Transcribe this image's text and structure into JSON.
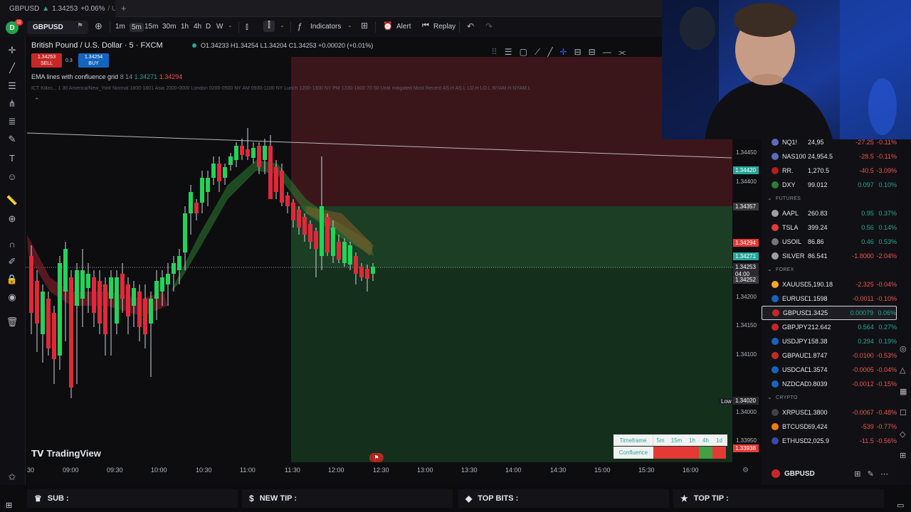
{
  "tab": {
    "symbol": "GBPUSD",
    "price": "1.34253",
    "change": "+0.06%",
    "title_rest": "/ Unn"
  },
  "toolbar": {
    "avatar_letter": "D",
    "avatar_badge": "11",
    "symbol": "GBPUSD",
    "intervals": [
      "1m",
      "5m",
      "15m",
      "30m",
      "1h",
      "4h",
      "D",
      "W"
    ],
    "active_interval": "5m",
    "indicators_label": "Indicators",
    "alert_label": "Alert",
    "replay_label": "Replay"
  },
  "legend": {
    "title": "British Pound / U.S. Dollar · 5 · FXCM",
    "ohlc": "O1.34233  H1.34254  L1.34204  C1.34253  +0.00020 (+0.01%)",
    "sell_price": "1.34253",
    "sell_label": "SELL",
    "buy_price": "1.34254",
    "buy_label": "BUY",
    "spread": "0.3",
    "indicator_name": "EMA lines with confluence grid",
    "indicator_param": "8 14",
    "indicator_v1": "1.34271",
    "indicator_v2": "1.34294",
    "ict_text": "ICT Killzo... 1 30 America/New_York Normal 1800-1801 Asia 2000-0000 London 0200-0500 NY AM 0930-1100 NY Lunch 1200-1300 NY PM 1330-1600 70 50 Until mitigated Most Recent AS.H AS.L LO.H LO.L NYAM.H NYAM.L"
  },
  "brand": "TradingView",
  "price_axis": {
    "labels": [
      {
        "text": "1.34450",
        "p": 1.3445
      },
      {
        "text": "1.34400",
        "p": 1.344
      },
      {
        "text": "1.34200",
        "p": 1.342
      },
      {
        "text": "1.34150",
        "p": 1.3415
      },
      {
        "text": "1.34100",
        "p": 1.341
      },
      {
        "text": "1.34000",
        "p": 1.34
      },
      {
        "text": "1.33950",
        "p": 1.3395
      }
    ],
    "tags": [
      {
        "text": "1.34420",
        "p": 1.3442,
        "color": "#26a69a"
      },
      {
        "text": "1.34357",
        "p": 1.34357,
        "color": "#3a3a3f"
      },
      {
        "text": "1.34294",
        "p": 1.34294,
        "color": "#e53935"
      },
      {
        "text": "1.34271",
        "p": 1.34271,
        "color": "#26a69a"
      },
      {
        "text": "1.34253",
        "p": 1.34253,
        "color": "#2a2a2f"
      },
      {
        "text": "04:00",
        "p": 1.3424,
        "color": "#2a2a2f"
      },
      {
        "text": "1.34252",
        "p": 1.3423,
        "color": "#3a3a3f"
      },
      {
        "text": "1.34020",
        "p": 1.3402,
        "color": "#2a2a2f"
      },
      {
        "text": "1.33938",
        "p": 1.33938,
        "color": "#e53935"
      }
    ],
    "low_label": "Low"
  },
  "time_axis": [
    "30",
    "09:00",
    "09:30",
    "10:00",
    "10:30",
    "11:00",
    "11:30",
    "12:00",
    "12:30",
    "13:00",
    "13:30",
    "14:00",
    "14:30",
    "15:00",
    "15:30",
    "16:00"
  ],
  "tf_table": {
    "header": "Timeframe",
    "cols": [
      "5m",
      "15m",
      "1h",
      "4h",
      "1d"
    ],
    "row_label": "Confluence",
    "cell_colors": [
      "#e53935",
      "#e53935",
      "#e53935",
      "#43a047",
      "#e53935"
    ]
  },
  "watchlist": {
    "rows": [
      {
        "sym": "NQ1!",
        "last": "24,95",
        "chg": "-27.25",
        "pct": "-0.11%",
        "color": "#ef5350",
        "icon": "#5c6bc0"
      },
      {
        "sym": "NAS100",
        "last": "24,954.5",
        "chg": "-28.5",
        "pct": "-0.11%",
        "color": "#ef5350",
        "icon": "#5c6bc0"
      },
      {
        "sym": "RR.",
        "last": "1,270.5",
        "chg": "-40.5",
        "pct": "-3.09%",
        "color": "#ef5350",
        "icon": "#b71c1c"
      },
      {
        "sym": "DXY",
        "last": "99.012",
        "chg": "0.097",
        "pct": "0.10%",
        "color": "#26a69a",
        "icon": "#2e7d32"
      },
      {
        "section": "FUTURES"
      },
      {
        "sym": "AAPL",
        "last": "260.83",
        "chg": "0.95",
        "pct": "0.37%",
        "color": "#26a69a",
        "icon": "#9e9e9e"
      },
      {
        "sym": "TSLA",
        "last": "399.24",
        "chg": "0.56",
        "pct": "0.14%",
        "color": "#26a69a",
        "icon": "#e53935"
      },
      {
        "sym": "USOIL",
        "last": "86.86",
        "chg": "0.46",
        "pct": "0.53%",
        "color": "#26a69a",
        "icon": "#757575"
      },
      {
        "sym": "SILVER",
        "last": "86.541",
        "chg": "-1.8000",
        "pct": "-2.04%",
        "color": "#ef5350",
        "icon": "#9e9e9e"
      },
      {
        "section": "FOREX"
      },
      {
        "sym": "XAUUSD",
        "last": "5,190.18",
        "chg": "-2.325",
        "pct": "-0.04%",
        "color": "#ef5350",
        "icon": "#f9a825"
      },
      {
        "sym": "EURUSD",
        "last": "1.1598",
        "chg": "-0.0011",
        "pct": "-0.10%",
        "color": "#ef5350",
        "icon": "#1565c0"
      },
      {
        "sym": "GBPUSD",
        "last": "1.3425",
        "chg": "0.00079",
        "pct": "0.06%",
        "color": "#26a69a",
        "icon": "#c62828",
        "sel": true
      },
      {
        "sym": "GBPJPY",
        "last": "212.642",
        "chg": "0.564",
        "pct": "0.27%",
        "color": "#26a69a",
        "icon": "#c62828"
      },
      {
        "sym": "USDJPY",
        "last": "158.38",
        "chg": "0.294",
        "pct": "0.19%",
        "color": "#26a69a",
        "icon": "#1565c0"
      },
      {
        "sym": "GBPAUD",
        "last": "1.8747",
        "chg": "-0.0100",
        "pct": "-0.53%",
        "color": "#ef5350",
        "icon": "#c62828"
      },
      {
        "sym": "USDCAD",
        "last": "1.3574",
        "chg": "-0.0005",
        "pct": "-0.04%",
        "color": "#ef5350",
        "icon": "#1565c0"
      },
      {
        "sym": "NZDCAD",
        "last": "0.8039",
        "chg": "-0.0012",
        "pct": "-0.15%",
        "color": "#ef5350",
        "icon": "#1565c0"
      },
      {
        "section": "CRYPTO"
      },
      {
        "sym": "XRPUSD",
        "last": "1.3800",
        "chg": "-0.0067",
        "pct": "-0.48%",
        "color": "#ef5350",
        "icon": "#424242"
      },
      {
        "sym": "BTCUSD",
        "last": "69,424",
        "chg": "-539",
        "pct": "-0.77%",
        "color": "#ef5350",
        "icon": "#f57c00"
      },
      {
        "sym": "ETHUSD",
        "last": "2,025.9",
        "chg": "-11.5",
        "pct": "-0.56%",
        "color": "#ef5350",
        "icon": "#3949ab"
      }
    ],
    "footer_symbol": "GBPUSD"
  },
  "bottom_bar": [
    {
      "label": "SUB :",
      "icon": "crown-icon"
    },
    {
      "label": "NEW TIP :",
      "icon": "dollar-icon"
    },
    {
      "label": "TOP BITS :",
      "icon": "diamond-icon"
    },
    {
      "label": "TOP TIP :",
      "icon": "star-icon"
    }
  ],
  "colors": {
    "up": "#26a69a",
    "down": "#ef5350",
    "candle_up": "#22d35a",
    "candle_down": "#e0283a"
  }
}
